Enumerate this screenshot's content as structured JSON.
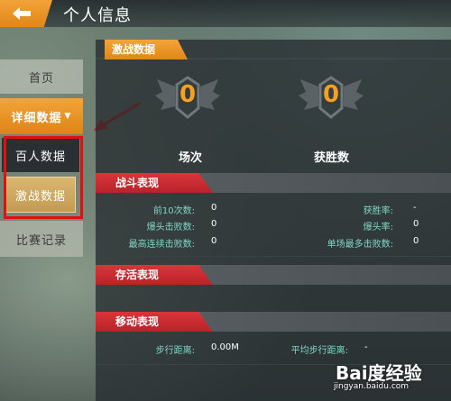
{
  "header": {
    "title": "个人信息",
    "back_icon": "back-arrow-icon"
  },
  "nav": {
    "home": "首页",
    "details": "详细数据",
    "details_arrow": "▼",
    "hundred": "百人数据",
    "battle": "激战数据",
    "records": "比赛记录"
  },
  "main": {
    "tab": "激战数据",
    "matches": {
      "value": "0",
      "label": "场次"
    },
    "wins": {
      "value": "0",
      "label": "获胜数"
    },
    "combat": {
      "title": "战斗表现",
      "rows": [
        {
          "label": "前10次数:",
          "value": "0"
        },
        {
          "label": "爆头击败数:",
          "value": "0"
        },
        {
          "label": "最高连续击败数:",
          "value": "0"
        }
      ],
      "rows_right": [
        {
          "label": "获胜率:",
          "value": "-"
        },
        {
          "label": "爆头率:",
          "value": "0"
        },
        {
          "label": "单场最多击败数:",
          "value": "0"
        }
      ]
    },
    "survival": {
      "title": "存活表现"
    },
    "movement": {
      "title": "移动表现",
      "walk_label": "步行距离:",
      "walk_value": "0.00M",
      "avg_walk_label": "平均步行距离:",
      "avg_walk_value": "-"
    }
  },
  "watermark": {
    "logo": "Bai度经验",
    "url": "jingyan.baidu.com"
  },
  "colors": {
    "accent_orange": "#e08718",
    "highlight_red": "#e01010",
    "section_red": "#c42a30",
    "value_orange": "#f5a020",
    "label_teal": "#7fd6c8"
  }
}
